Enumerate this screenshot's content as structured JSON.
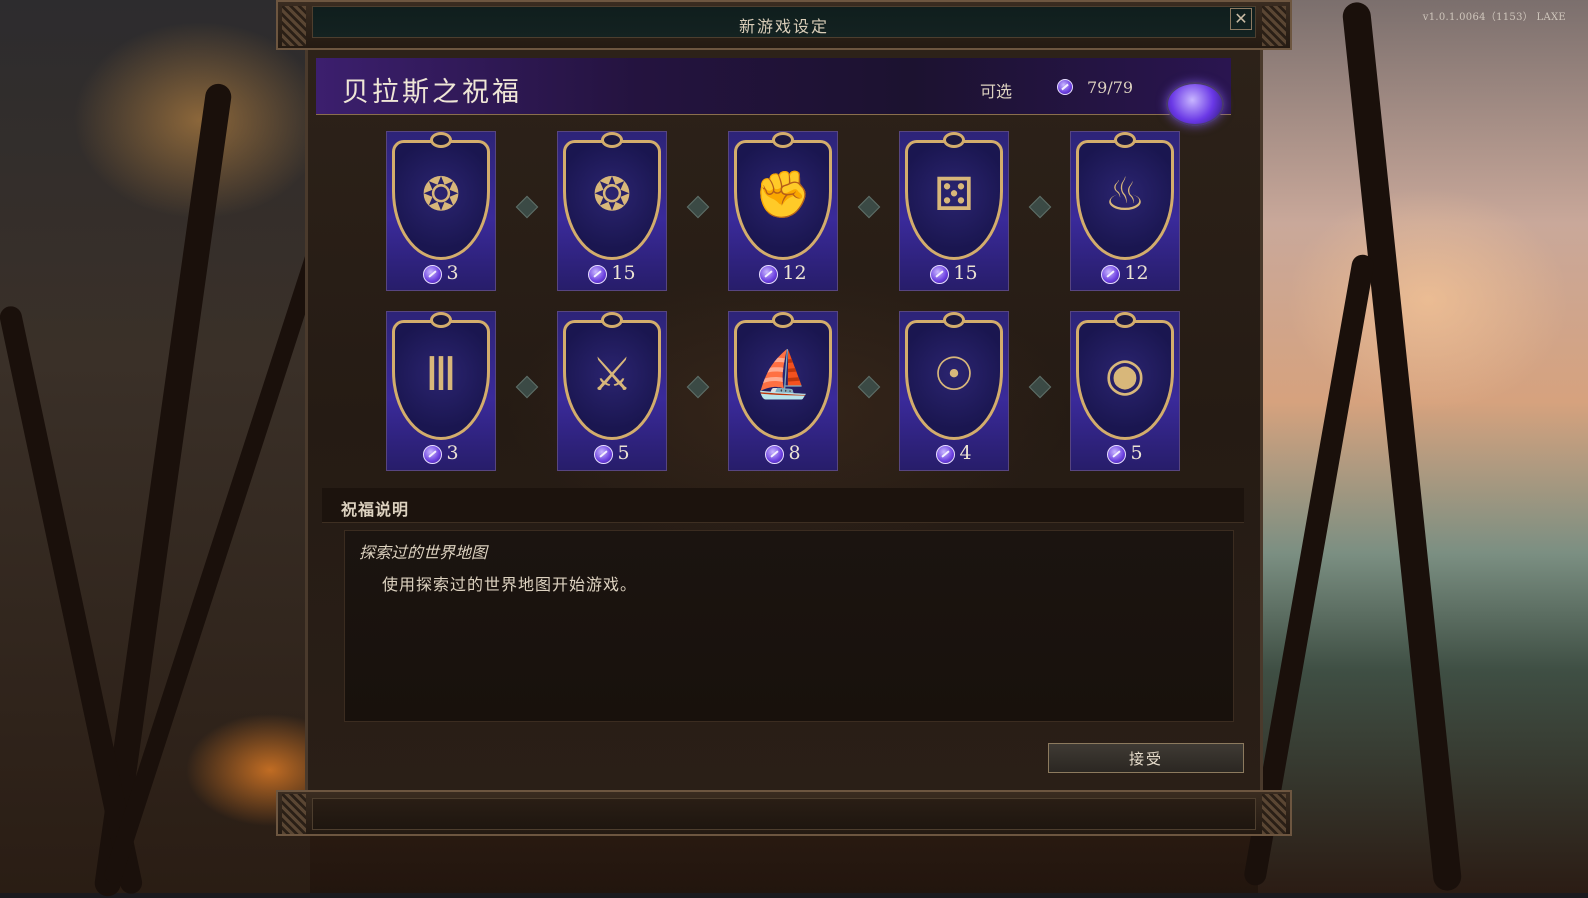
{
  "version": "v1.0.1.0064（1153） LAXE",
  "window": {
    "title": "新游戏设定",
    "close_icon": "close-icon"
  },
  "header": {
    "title": "贝拉斯之祝福",
    "available_label": "可选",
    "available_value": "79/79"
  },
  "blessings": [
    {
      "icon": "coins-small-icon",
      "glyph": "❂",
      "cost": "3"
    },
    {
      "icon": "coins-large-icon",
      "glyph": "❂",
      "cost": "15"
    },
    {
      "icon": "fist-icon",
      "glyph": "✊",
      "cost": "12"
    },
    {
      "icon": "dice-icon",
      "glyph": "⚄",
      "cost": "15"
    },
    {
      "icon": "pipe-icon",
      "glyph": "♨",
      "cost": "12"
    },
    {
      "icon": "pillar-icon",
      "glyph": "Ⅲ",
      "cost": "3"
    },
    {
      "icon": "weapons-icon",
      "glyph": "⚔",
      "cost": "5"
    },
    {
      "icon": "ship-icon",
      "glyph": "⛵",
      "cost": "8"
    },
    {
      "icon": "spyglass-icon",
      "glyph": "☉",
      "cost": "4"
    },
    {
      "icon": "medallion-icon",
      "glyph": "◉",
      "cost": "5"
    }
  ],
  "description": {
    "header": "祝福说明",
    "title": "探索过的世界地图",
    "body": "使用探索过的世界地图开始游戏。"
  },
  "accept_label": "接受",
  "colors": {
    "accent_gold": "#d3ad6c",
    "card_purple": "#3a2a9a",
    "point_purple": "#6b3fe0"
  }
}
